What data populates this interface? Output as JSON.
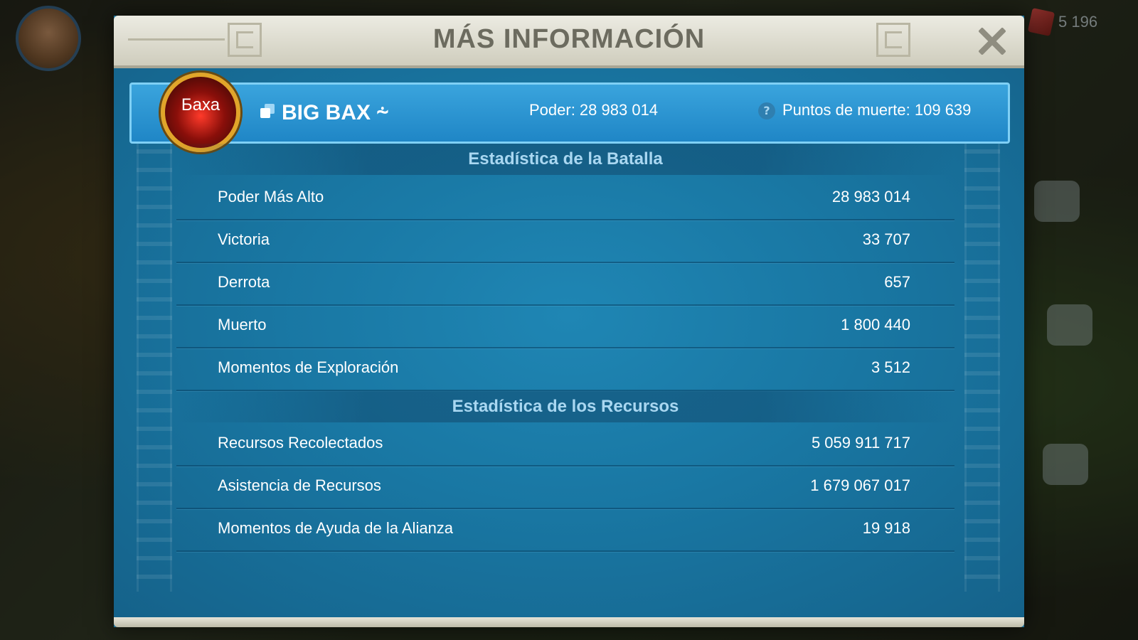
{
  "background": {
    "gem_count": "5 196"
  },
  "dialog": {
    "title": "MÁS INFORMACIÓN"
  },
  "player": {
    "avatar_name": "Баха",
    "name": "BIG BAX ⸞",
    "power": "Poder: 28 983 014",
    "death_points": "Puntos de muerte: 109 639"
  },
  "battle_stats": {
    "title": "Estadística de la Batalla",
    "rows": [
      {
        "label": "Poder Más Alto",
        "value": "28 983 014"
      },
      {
        "label": "Victoria",
        "value": "33 707"
      },
      {
        "label": "Derrota",
        "value": "657"
      },
      {
        "label": "Muerto",
        "value": "1 800 440"
      },
      {
        "label": "Momentos de Exploración",
        "value": "3 512"
      }
    ]
  },
  "resource_stats": {
    "title": "Estadística de los Recursos",
    "rows": [
      {
        "label": "Recursos Recolectados",
        "value": "5 059 911 717"
      },
      {
        "label": "Asistencia de Recursos",
        "value": "1 679 067 017"
      },
      {
        "label": "Momentos de Ayuda de la Alianza",
        "value": "19 918"
      }
    ]
  },
  "colors": {
    "panel_blue": "#1a77a3",
    "header_cream": "#e3e1d4",
    "section_title": "#a9d7f1",
    "avatar_ring": "#e1a52a"
  }
}
